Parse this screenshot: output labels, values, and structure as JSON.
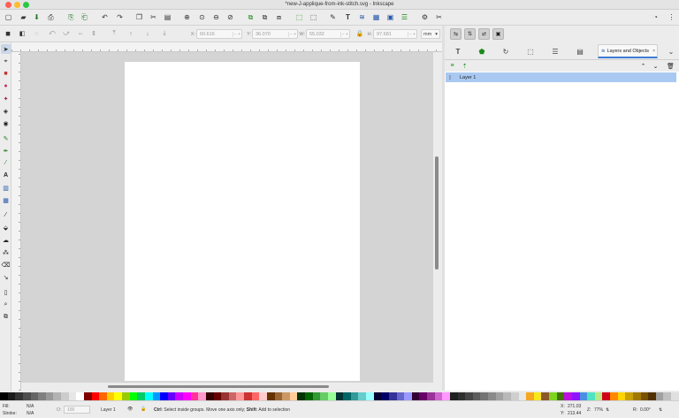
{
  "window": {
    "title": "*new-J-applique-from-ink-stitch.svg - Inkscape"
  },
  "toolbar_icons": [
    "new-icon",
    "open-icon",
    "save-icon",
    "print-icon",
    "import-icon",
    "export-icon",
    "undo-icon",
    "redo-icon",
    "copy-icon",
    "cut-icon",
    "paste-icon",
    "zoom-selection-icon",
    "zoom-drawing-icon",
    "zoom-page-icon",
    "zoom-width-icon",
    "duplicate-icon",
    "clone-icon",
    "unlink-clone-icon",
    "group-icon",
    "ungroup-icon",
    "fill-stroke-icon",
    "text-font-icon",
    "layers-icon",
    "xml-editor-icon",
    "align-icon",
    "preferences-icon",
    "document-properties-icon"
  ],
  "selector_controls": {
    "x": {
      "label": "X:",
      "value": "60.616"
    },
    "y": {
      "label": "Y:",
      "value": "36.070"
    },
    "w": {
      "label": "W:",
      "value": "55.032"
    },
    "h": {
      "label": "H:",
      "value": "97.681"
    },
    "unit": "mm"
  },
  "dock": {
    "active_tab": "Layers and Objects",
    "layers": [
      {
        "name": "Layer 1",
        "selected": true
      }
    ]
  },
  "palette": {
    "colors": [
      "#000000",
      "#1a1a1a",
      "#333333",
      "#4d4d4d",
      "#666666",
      "#808080",
      "#999999",
      "#b3b3b3",
      "#cccccc",
      "#e6e6e6",
      "#ffffff",
      "#800000",
      "#ff0000",
      "#ff6600",
      "#ffcc00",
      "#ffff00",
      "#99cc00",
      "#00ff00",
      "#00cc66",
      "#00ffff",
      "#0099ff",
      "#0000ff",
      "#6600ff",
      "#cc00ff",
      "#ff00ff",
      "#ff3399",
      "#ff99cc",
      "#330000",
      "#660000",
      "#993333",
      "#cc6666",
      "#ff9999",
      "#cc3333",
      "#ff6666",
      "#ffcccc",
      "#663300",
      "#996633",
      "#cc9966",
      "#ffcc99",
      "#003300",
      "#006600",
      "#339933",
      "#66cc66",
      "#99ff99",
      "#003333",
      "#006666",
      "#339999",
      "#66cccc",
      "#99ffff",
      "#000033",
      "#000066",
      "#333399",
      "#6666cc",
      "#9999ff",
      "#330033",
      "#660066",
      "#993399",
      "#cc66cc",
      "#ff99ff",
      "#1f1f1f",
      "#2e2e2e",
      "#454545",
      "#5c5c5c",
      "#737373",
      "#8a8a8a",
      "#a1a1a1",
      "#b8b8b8",
      "#cfcfcf",
      "#e8e8e8",
      "#f5a623",
      "#f8e71c",
      "#8b572a",
      "#7ed321",
      "#417505",
      "#bd10e0",
      "#9013fe",
      "#4a90e2",
      "#50e3c2",
      "#b8e986",
      "#d0021b",
      "#ff8800",
      "#ffd400",
      "#c8a000",
      "#a07800",
      "#785000",
      "#503000",
      "#a0a0a0",
      "#c0c0c0",
      "#e0e0e0"
    ]
  },
  "status": {
    "fill_label": "Fill:",
    "fill_value": "N/A",
    "stroke_label": "Stroke:",
    "stroke_value": "N/A",
    "opacity_label": "O:",
    "opacity_value": "100",
    "layer": "Layer 1",
    "message_bold1": "Ctrl",
    "message_text1": ": Select inside groups. Move one axis only; ",
    "message_bold2": "Shift",
    "message_text2": ": Add to selection",
    "coord_x_label": "X:",
    "coord_x": "271.03",
    "coord_y_label": "Y:",
    "coord_y": "213.44",
    "zoom_label": "Z:",
    "zoom": "77%",
    "rotation_label": "R:",
    "rotation": "0.00°"
  }
}
